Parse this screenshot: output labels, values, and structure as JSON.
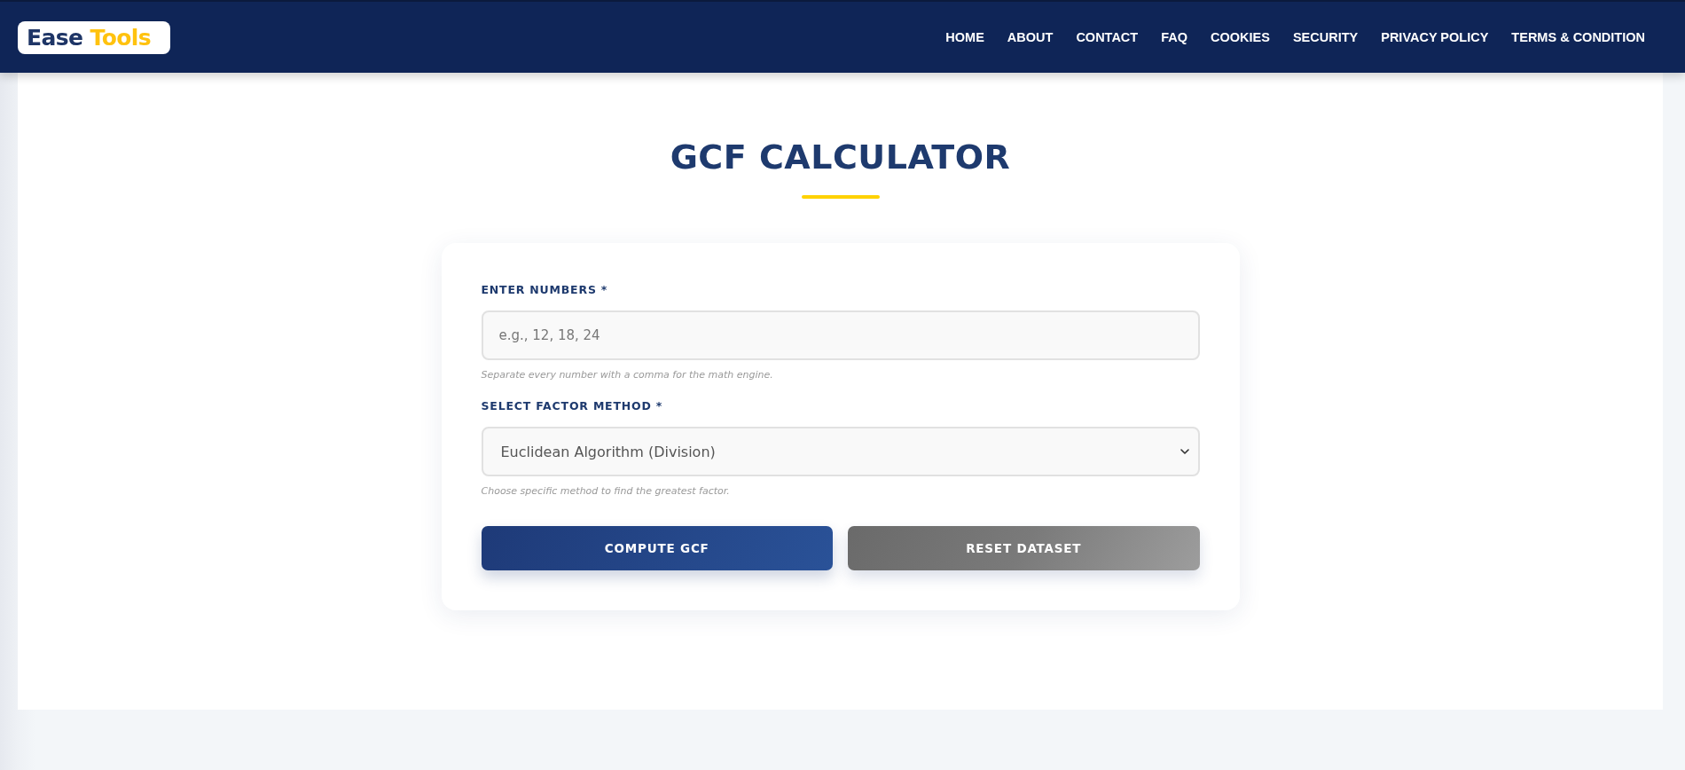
{
  "header": {
    "logo": {
      "parts": [
        "Ease",
        "Tools"
      ]
    },
    "nav": [
      "HOME",
      "ABOUT",
      "CONTACT",
      "FAQ",
      "COOKIES",
      "SECURITY",
      "PRIVACY POLICY",
      "TERMS & CONDITION"
    ]
  },
  "page": {
    "title": "GCF CALCULATOR"
  },
  "form": {
    "fields": [
      {
        "kind": "text",
        "label": "ENTER NUMBERS *",
        "placeholder": "e.g., 12, 18, 24",
        "hint": "Separate every number with a comma for the math engine."
      },
      {
        "kind": "select",
        "label": "SELECT FACTOR METHOD *",
        "value": "Euclidean Algorithm (Division)",
        "hint": "Choose specific method to find the greatest factor."
      }
    ],
    "buttons": [
      {
        "kind": "primary",
        "label": "COMPUTE GCF"
      },
      {
        "kind": "secondary",
        "label": "RESET DATASET"
      }
    ]
  }
}
